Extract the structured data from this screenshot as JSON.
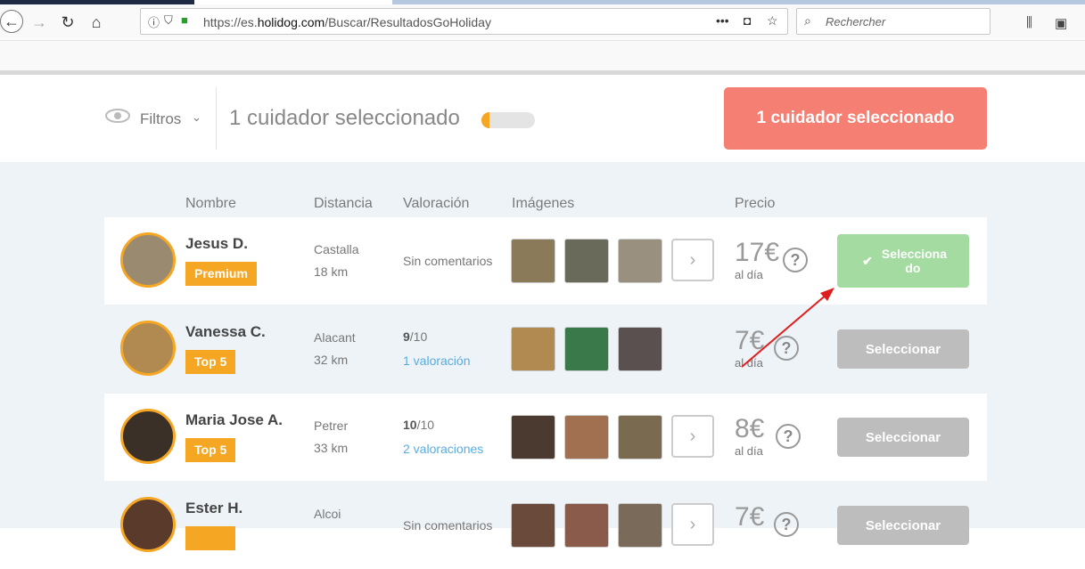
{
  "browser": {
    "url_prefix": "https://es.",
    "url_domain": "holidog.com",
    "url_path": "/Buscar/ResultadosGoHoliday",
    "search_placeholder": "Rechercher"
  },
  "header": {
    "filters_label": "Filtros",
    "selected_count_text": "1 cuidador seleccionado",
    "selected_progress": 0.15,
    "selected_button_label": "1 cuidador seleccionado"
  },
  "columns": {
    "name": "Nombre",
    "distance": "Distancia",
    "rating": "Valoración",
    "images": "Imágenes",
    "price": "Precio"
  },
  "sitters": [
    {
      "name": "Jesus D.",
      "badge": "Premium",
      "city": "Castalla",
      "distance": "18 km",
      "rating_score": "",
      "rating_scale": "",
      "reviews": "",
      "no_comments": "Sin comentarios",
      "price": "17€",
      "per_day": "al día",
      "button_label": "Selecciona do",
      "selected": true,
      "has_more_images": true
    },
    {
      "name": "Vanessa C.",
      "badge": "Top 5",
      "city": "Alacant",
      "distance": "32 km",
      "rating_score": "9",
      "rating_scale": "/10",
      "reviews": "1 valoración",
      "no_comments": "",
      "price": "7€",
      "per_day": "al día",
      "button_label": "Seleccionar",
      "selected": false,
      "has_more_images": false
    },
    {
      "name": "Maria Jose A.",
      "badge": "Top 5",
      "city": "Petrer",
      "distance": "33 km",
      "rating_score": "10",
      "rating_scale": "/10",
      "reviews": "2 valoraciones",
      "no_comments": "",
      "price": "8€",
      "per_day": "al día",
      "button_label": "Seleccionar",
      "selected": false,
      "has_more_images": true
    },
    {
      "name": "Ester H.",
      "badge": "",
      "city": "Alcoi",
      "distance": "",
      "rating_score": "",
      "rating_scale": "",
      "reviews": "",
      "no_comments": "Sin comentarios",
      "price": "7€",
      "per_day": "",
      "button_label": "Seleccionar",
      "selected": false,
      "has_more_images": true
    }
  ],
  "colors": {
    "accent_orange": "#f5a623",
    "cta_red": "#f47f72",
    "selected_green": "#a3dba0",
    "link_blue": "#5aace0"
  }
}
